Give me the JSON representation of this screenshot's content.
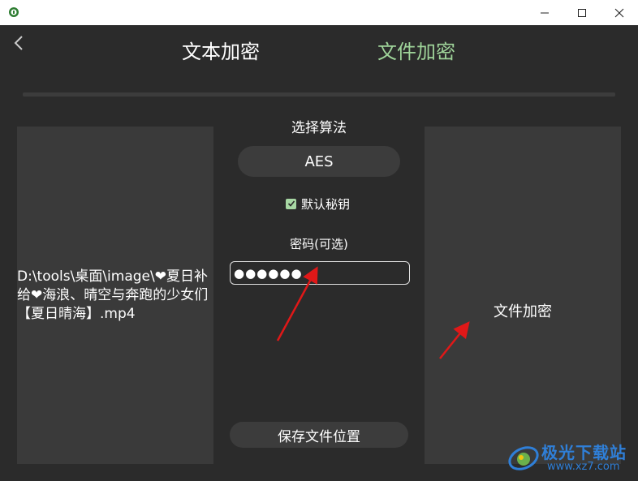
{
  "window": {
    "icon": "app-shield-icon",
    "controls": [
      "minimize-icon",
      "maximize-icon",
      "close-icon"
    ]
  },
  "nav": {
    "back_icon": "chevron-left-icon",
    "tabs": [
      {
        "label": "文本加密",
        "active": false
      },
      {
        "label": "文件加密",
        "active": true
      }
    ],
    "active_color": "#9fd49a"
  },
  "left_panel": {
    "file_path": "D:\\tools\\桌面\\image\\❤夏日补给❤海浪、晴空与奔跑的少女们【夏日晴海】.mp4"
  },
  "center": {
    "algorithm_label": "选择算法",
    "algorithm_value": "AES",
    "default_key_checked": true,
    "default_key_label": "默认秘钥",
    "password_label": "密码(可选)",
    "password_value": "●●●●●●",
    "save_location_label": "保存文件位置"
  },
  "right_panel": {
    "action_label": "文件加密"
  },
  "watermark": {
    "title": "极光下载站",
    "url": "www.xz7.com"
  }
}
